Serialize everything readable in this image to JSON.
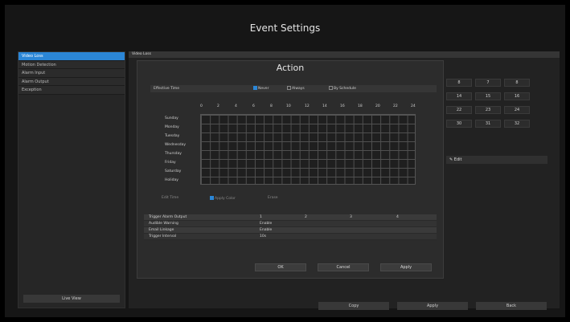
{
  "window": {
    "title": "Event Settings"
  },
  "sidebar": {
    "items": [
      {
        "label": "Video Loss",
        "active": true
      },
      {
        "label": "Motion Detection",
        "active": false
      },
      {
        "label": "Alarm Input",
        "active": false
      },
      {
        "label": "Alarm Output",
        "active": false
      },
      {
        "label": "Exception",
        "active": false
      }
    ],
    "live_view_label": "Live View"
  },
  "content": {
    "tab_label": "Video Loss",
    "bg_channels": [
      "8",
      "7",
      "8",
      "14",
      "15",
      "16",
      "22",
      "23",
      "24",
      "30",
      "31",
      "32"
    ],
    "edit_label": "Edit",
    "buttons": {
      "copy": "Copy",
      "apply": "Apply",
      "back": "Back"
    }
  },
  "dialog": {
    "title": "Action",
    "effective_time": {
      "label": "Effective Time",
      "options": [
        {
          "label": "Never",
          "checked": true
        },
        {
          "label": "Always",
          "checked": false
        },
        {
          "label": "By Schedule",
          "checked": false
        }
      ]
    },
    "hours": [
      "0",
      "2",
      "4",
      "6",
      "8",
      "10",
      "12",
      "14",
      "16",
      "18",
      "20",
      "22",
      "24"
    ],
    "days": [
      "Sunday",
      "Monday",
      "Tuesday",
      "Wednesday",
      "Thursday",
      "Friday",
      "Saturday",
      "Holiday"
    ],
    "edit_time_label": "Edit Time",
    "apply_color_label": "Apply Color",
    "erase_label": "Erase",
    "table": [
      {
        "label": "Trigger Alarm Output",
        "values": [
          "1",
          "2",
          "3",
          "4"
        ]
      },
      {
        "label": "Audible Warning",
        "values": [
          "Enable"
        ]
      },
      {
        "label": "Email Linkage",
        "values": [
          "Enable"
        ]
      },
      {
        "label": "Trigger Interval",
        "values": [
          "10s"
        ]
      }
    ],
    "buttons": {
      "ok": "OK",
      "cancel": "Cancel",
      "apply": "Apply"
    }
  },
  "colors": {
    "accent": "#2b86d6",
    "background": "#161616",
    "panel": "#2c2c2c"
  }
}
